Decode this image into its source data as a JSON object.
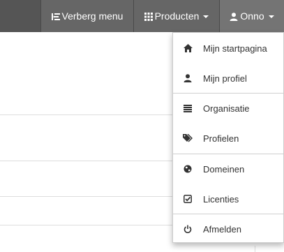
{
  "topbar": {
    "hide_menu_label": "Verberg menu",
    "products_label": "Producten",
    "user_label": "Onno"
  },
  "dropdown": {
    "items": [
      {
        "label": "Mijn startpagina",
        "icon": "home-icon"
      },
      {
        "label": "Mijn profiel",
        "icon": "user-icon"
      },
      {
        "label": "Organisatie",
        "icon": "list-icon"
      },
      {
        "label": "Profielen",
        "icon": "tags-icon"
      },
      {
        "label": "Domeinen",
        "icon": "globe-icon"
      },
      {
        "label": "Licenties",
        "icon": "check-square-icon"
      },
      {
        "label": "Afmelden",
        "icon": "power-icon"
      }
    ]
  },
  "colors": {
    "topbar_bg": "#5e5e5e",
    "menu_text": "#333333",
    "divider": "#cfcfcf"
  }
}
